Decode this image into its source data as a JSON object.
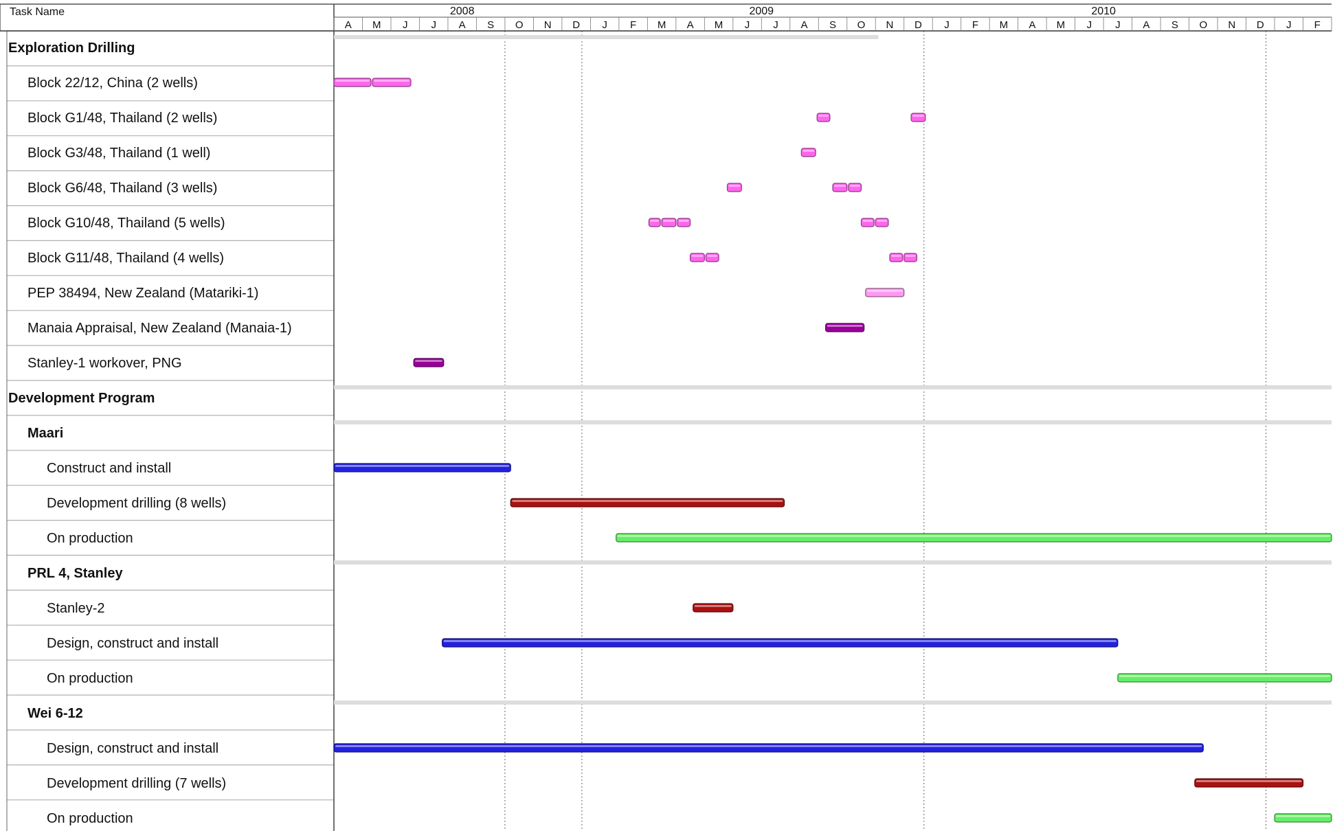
{
  "chart_data": {
    "type": "gantt",
    "header": {
      "task_column": "Task Name"
    },
    "timeline": {
      "start": "2008-04",
      "end": "2011-03"
    },
    "years": [
      {
        "label": "2008",
        "start": "2008-04",
        "end": "2008-12"
      },
      {
        "label": "2009",
        "start": "2009-01",
        "end": "2009-12"
      },
      {
        "label": "2010",
        "start": "2010-01",
        "end": "2010-12"
      }
    ],
    "months": [
      "A",
      "M",
      "J",
      "J",
      "A",
      "S",
      "O",
      "N",
      "D",
      "J",
      "F",
      "M",
      "A",
      "M",
      "J",
      "J",
      "A",
      "S",
      "O",
      "N",
      "D",
      "J",
      "F",
      "M",
      "A",
      "M",
      "J",
      "J",
      "A",
      "S",
      "O",
      "N",
      "D",
      "J",
      "F",
      "M"
    ],
    "vertical_gridlines": [
      "2008-10",
      "2008-12.7",
      "2009-12.7",
      "2010-12.7"
    ],
    "colors": {
      "exploration": "#ff66ee",
      "exploration_light": "#ff99f0",
      "appraisal": "#990099",
      "construct": "#2222dd",
      "drilling": "#aa1111",
      "production": "#66ee66",
      "summary": "#dddddd"
    },
    "tasks": [
      {
        "name": "Exploration Drilling",
        "level": 0,
        "bold": true,
        "summary": true,
        "bars": [
          {
            "start": "2008-04",
            "end": "2009-11.1",
            "color": "summary"
          }
        ]
      },
      {
        "name": "Block 22/12, China (2 wells)",
        "level": 1,
        "bars": [
          {
            "start": "2008-04",
            "end": "2008-05.3",
            "color": "exploration"
          },
          {
            "start": "2008-05.35",
            "end": "2008-06.7",
            "color": "exploration"
          }
        ]
      },
      {
        "name": "Block G1/48, Thailand (2 wells)",
        "level": 1,
        "bars": [
          {
            "start": "2009-08.95",
            "end": "2009-09.4",
            "color": "exploration"
          },
          {
            "start": "2009-12.25",
            "end": "2009-12.75",
            "color": "exploration"
          }
        ]
      },
      {
        "name": "Block G3/48, Thailand (1 well)",
        "level": 1,
        "bars": [
          {
            "start": "2009-08.4",
            "end": "2009-08.9",
            "color": "exploration"
          }
        ]
      },
      {
        "name": "Block G6/48, Thailand (3 wells)",
        "level": 1,
        "bars": [
          {
            "start": "2009-05.8",
            "end": "2009-06.3",
            "color": "exploration"
          },
          {
            "start": "2009-09.5",
            "end": "2009-10.0",
            "color": "exploration"
          },
          {
            "start": "2009-10.05",
            "end": "2009-10.5",
            "color": "exploration"
          }
        ]
      },
      {
        "name": "Block G10/48, Thailand (5 wells)",
        "level": 1,
        "bars": [
          {
            "start": "2009-03.05",
            "end": "2009-03.45",
            "color": "exploration"
          },
          {
            "start": "2009-03.5",
            "end": "2009-04.0",
            "color": "exploration"
          },
          {
            "start": "2009-04.05",
            "end": "2009-04.5",
            "color": "exploration"
          },
          {
            "start": "2009-10.5",
            "end": "2009-10.95",
            "color": "exploration"
          },
          {
            "start": "2009-11.0",
            "end": "2009-11.45",
            "color": "exploration"
          }
        ]
      },
      {
        "name": "Block G11/48, Thailand (4 wells)",
        "level": 1,
        "bars": [
          {
            "start": "2009-04.5",
            "end": "2009-05.0",
            "color": "exploration"
          },
          {
            "start": "2009-05.05",
            "end": "2009-05.5",
            "color": "exploration"
          },
          {
            "start": "2009-11.5",
            "end": "2009-11.95",
            "color": "exploration"
          },
          {
            "start": "2009-12.0",
            "end": "2009-12.45",
            "color": "exploration"
          }
        ]
      },
      {
        "name": "PEP 38494, New Zealand (Matariki-1)",
        "level": 1,
        "bars": [
          {
            "start": "2009-10.65",
            "end": "2009-12.0",
            "color": "exploration_light"
          }
        ]
      },
      {
        "name": "Manaia Appraisal, New Zealand (Manaia-1)",
        "level": 1,
        "bars": [
          {
            "start": "2009-09.25",
            "end": "2009-10.6",
            "color": "appraisal"
          }
        ]
      },
      {
        "name": "Stanley-1 workover, PNG",
        "level": 1,
        "bars": [
          {
            "start": "2008-06.8",
            "end": "2008-07.85",
            "color": "appraisal"
          }
        ]
      },
      {
        "name": "Development Program",
        "level": 0,
        "bold": true,
        "summary": true,
        "bars": [
          {
            "start": "2008-04",
            "end": "2011-03",
            "color": "summary"
          }
        ]
      },
      {
        "name": "Maari",
        "level": 1,
        "bold": true,
        "summary": true,
        "bars": [
          {
            "start": "2008-04",
            "end": "2011-03",
            "color": "summary"
          }
        ]
      },
      {
        "name": "Construct and install",
        "level": 2,
        "bars": [
          {
            "start": "2008-04",
            "end": "2008-10.2",
            "color": "construct"
          }
        ]
      },
      {
        "name": "Development drilling (8 wells)",
        "level": 2,
        "bars": [
          {
            "start": "2008-10.2",
            "end": "2009-07.8",
            "color": "drilling"
          }
        ]
      },
      {
        "name": "On production",
        "level": 2,
        "bars": [
          {
            "start": "2009-01.9",
            "end": "2011-03",
            "color": "production"
          }
        ]
      },
      {
        "name": "PRL 4, Stanley",
        "level": 1,
        "bold": true,
        "summary": true,
        "bars": [
          {
            "start": "2008-04",
            "end": "2011-03",
            "color": "summary"
          }
        ]
      },
      {
        "name": "Stanley-2",
        "level": 2,
        "bars": [
          {
            "start": "2009-04.6",
            "end": "2009-06.0",
            "color": "drilling"
          }
        ]
      },
      {
        "name": "Design, construct and install",
        "level": 2,
        "bars": [
          {
            "start": "2008-07.8",
            "end": "2010-07.5",
            "color": "construct"
          }
        ]
      },
      {
        "name": "On production",
        "level": 2,
        "bars": [
          {
            "start": "2010-07.5",
            "end": "2011-03",
            "color": "production"
          }
        ]
      },
      {
        "name": "Wei 6-12",
        "level": 1,
        "bold": true,
        "summary": true,
        "bars": [
          {
            "start": "2008-04",
            "end": "2011-03",
            "color": "summary"
          }
        ]
      },
      {
        "name": "Design, construct and install",
        "level": 2,
        "bars": [
          {
            "start": "2008-04",
            "end": "2010-10.5",
            "color": "construct"
          }
        ]
      },
      {
        "name": "Development drilling (7 wells)",
        "level": 2,
        "bars": [
          {
            "start": "2010-10.2",
            "end": "2011-02.0",
            "color": "drilling"
          }
        ]
      },
      {
        "name": "On production",
        "level": 2,
        "bars": [
          {
            "start": "2011-01.0",
            "end": "2011-03",
            "color": "production"
          }
        ]
      }
    ]
  }
}
